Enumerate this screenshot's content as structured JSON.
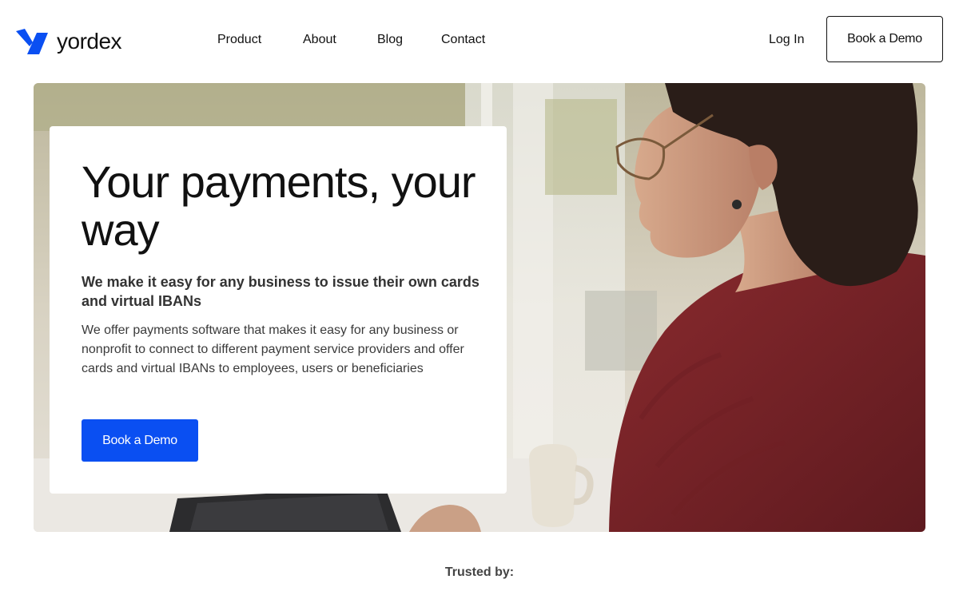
{
  "brand": {
    "name": "yordex",
    "accent_color": "#0a4ff2"
  },
  "nav": {
    "items": [
      {
        "label": "Product"
      },
      {
        "label": "About"
      },
      {
        "label": "Blog"
      },
      {
        "label": "Contact"
      }
    ],
    "login_label": "Log In",
    "cta_label": "Book a Demo"
  },
  "hero": {
    "headline": "Your payments, your way",
    "subheadline": "We make it easy for any business to issue their own cards and virtual IBANs",
    "body": "We offer payments software that makes it easy for any business or nonprofit to connect to different payment service providers and offer cards and virtual IBANs to employees, users or beneficiaries",
    "cta_label": "Book a Demo"
  },
  "trusted": {
    "label": "Trusted by:"
  }
}
